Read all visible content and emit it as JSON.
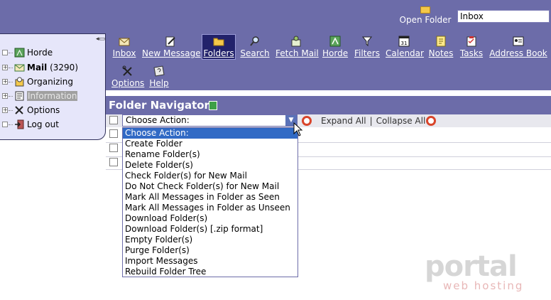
{
  "header": {
    "open_folder_label": "Open Folder",
    "folder_select_value": "Inbox"
  },
  "toolbar": {
    "items": [
      {
        "label": "Inbox",
        "icon": "envelope-icon"
      },
      {
        "label": "New Message",
        "icon": "compose-icon"
      },
      {
        "label": "Folders",
        "icon": "folder-icon"
      },
      {
        "label": "Search",
        "icon": "magnifier-icon"
      },
      {
        "label": "Fetch Mail",
        "icon": "fetch-mail-icon"
      },
      {
        "label": "Horde",
        "icon": "horde-icon"
      },
      {
        "label": "Filters",
        "icon": "funnel-icon"
      },
      {
        "label": "Calendar",
        "icon": "calendar-icon"
      },
      {
        "label": "Notes",
        "icon": "note-icon"
      },
      {
        "label": "Tasks",
        "icon": "tasks-icon"
      },
      {
        "label": "Address Book",
        "icon": "address-book-icon"
      }
    ],
    "row2": [
      {
        "label": "Options",
        "icon": "tools-icon"
      },
      {
        "label": "Help",
        "icon": "help-icon"
      }
    ],
    "calendar_day": "31",
    "active_color": "#22226b"
  },
  "sidebar": {
    "items": [
      {
        "label": "Horde",
        "icon": "horde-icon"
      },
      {
        "label": "Mail",
        "count": "(3290)",
        "icon": "mail-icon"
      },
      {
        "label": "Organizing",
        "icon": "organizing-icon"
      },
      {
        "label": "Information",
        "icon": "information-icon"
      },
      {
        "label": "Options",
        "icon": "tools-icon"
      },
      {
        "label": "Log out",
        "icon": "logout-icon"
      }
    ]
  },
  "navigator": {
    "title": "Folder Navigator",
    "action_select_value": "Choose Action:",
    "expand_all": "Expand All",
    "separator": "|",
    "collapse_all": "Collapse All"
  },
  "dropdown": {
    "options": [
      "Choose Action:",
      "Create Folder",
      "Rename Folder(s)",
      "Delete Folder(s)",
      "Check Folder(s) for New Mail",
      "Do Not Check Folder(s) for New Mail",
      "Mark All Messages in Folder as Seen",
      "Mark All Messages in Folder as Unseen",
      "Download Folder(s)",
      "Download Folder(s) [.zip format]",
      "Empty Folder(s)",
      "Purge Folder(s)",
      "Import Messages",
      "Rebuild Folder Tree"
    ],
    "selected_index": 0,
    "highlight_color": "#316ac5"
  },
  "watermark": {
    "brand": "portal",
    "tagline": "web hosting"
  },
  "colors": {
    "header_bg": "#6c6ca9",
    "sidebar_bg": "#e6e6fa"
  }
}
